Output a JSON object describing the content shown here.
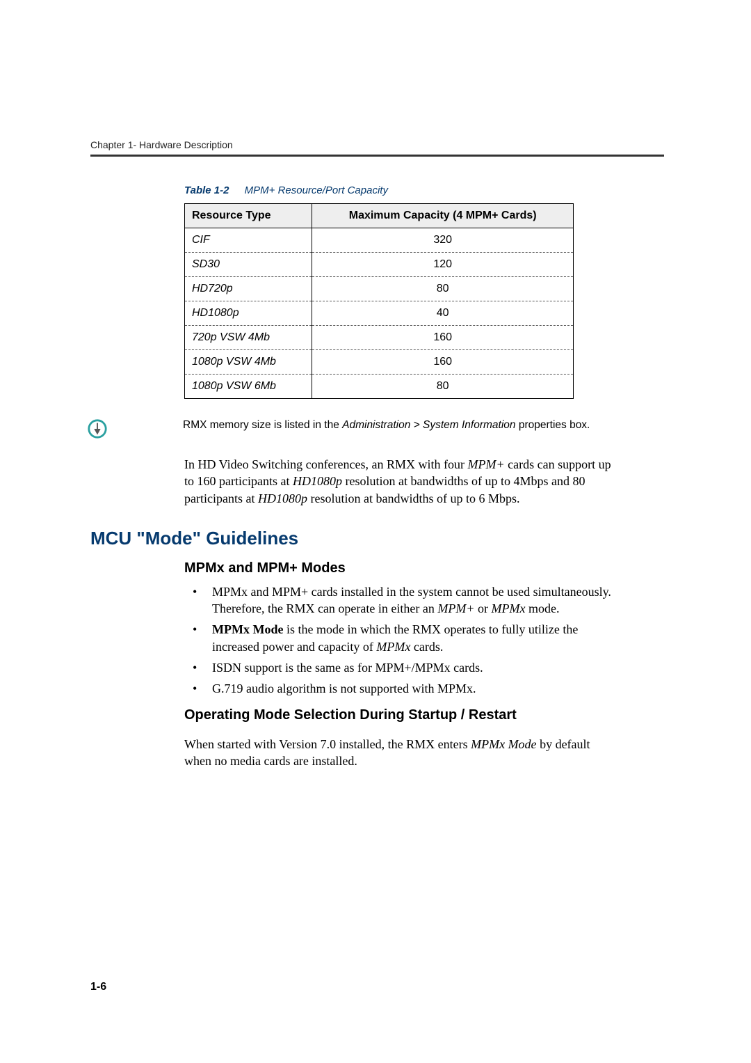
{
  "chapter_label": "Chapter 1- Hardware Description",
  "table": {
    "caption_label": "Table 1-2",
    "caption_title": "MPM+ Resource/Port Capacity",
    "headers": [
      "Resource Type",
      "Maximum Capacity (4 MPM+ Cards)"
    ],
    "rows": [
      {
        "type": "CIF",
        "value": "320"
      },
      {
        "type": "SD30",
        "value": "120"
      },
      {
        "type": "HD720p",
        "value": "80"
      },
      {
        "type": "HD1080p",
        "value": "40"
      },
      {
        "type": "720p VSW 4Mb",
        "value": "160"
      },
      {
        "type": "1080p VSW 4Mb",
        "value": "160"
      },
      {
        "type": "1080p VSW 6Mb",
        "value": "80"
      }
    ]
  },
  "note": {
    "pre": "RMX memory size is listed in the ",
    "mid": "Administration > System Information",
    "post": " properties box."
  },
  "body_para": {
    "t1": "In HD Video Switching conferences, an RMX with four ",
    "t2": "MPM+",
    "t3": " cards can support up to 160 participants at ",
    "t4": "HD1080p",
    "t5": " resolution at bandwidths of up to 4Mbps and 80 participants at ",
    "t6": "HD1080p",
    "t7": " resolution at bandwidths of up to 6 Mbps."
  },
  "section_heading": "MCU \"Mode\" Guidelines",
  "sub1_heading": "MPMx and MPM+ Modes",
  "bullets1": {
    "b1": {
      "t1": "MPMx and MPM+ cards installed in the system cannot be used simultaneously. Therefore, the RMX can operate in either an ",
      "t2": "MPM+",
      "t3": " or ",
      "t4": "MPMx",
      "t5": " mode."
    },
    "b2": {
      "t1": "MPMx Mode",
      "t2": " is the mode in which the RMX operates to fully utilize the increased power and capacity of ",
      "t3": "MPMx",
      "t4": " cards."
    },
    "b3": "ISDN support is the same as for MPM+/MPMx cards.",
    "b4": "G.719 audio algorithm is not supported with MPMx."
  },
  "sub2_heading": "Operating Mode Selection During Startup / Restart",
  "para2": {
    "t1": "When started with Version 7.0 installed, the RMX enters ",
    "t2": "MPMx Mode",
    "t3": " by default when no media cards are installed."
  },
  "page_number": "1-6",
  "chart_data": {
    "type": "table",
    "title": "MPM+ Resource/Port Capacity",
    "columns": [
      "Resource Type",
      "Maximum Capacity (4 MPM+ Cards)"
    ],
    "rows": [
      [
        "CIF",
        320
      ],
      [
        "SD30",
        120
      ],
      [
        "HD720p",
        80
      ],
      [
        "HD1080p",
        40
      ],
      [
        "720p VSW 4Mb",
        160
      ],
      [
        "1080p VSW 4Mb",
        160
      ],
      [
        "1080p VSW 6Mb",
        80
      ]
    ]
  }
}
